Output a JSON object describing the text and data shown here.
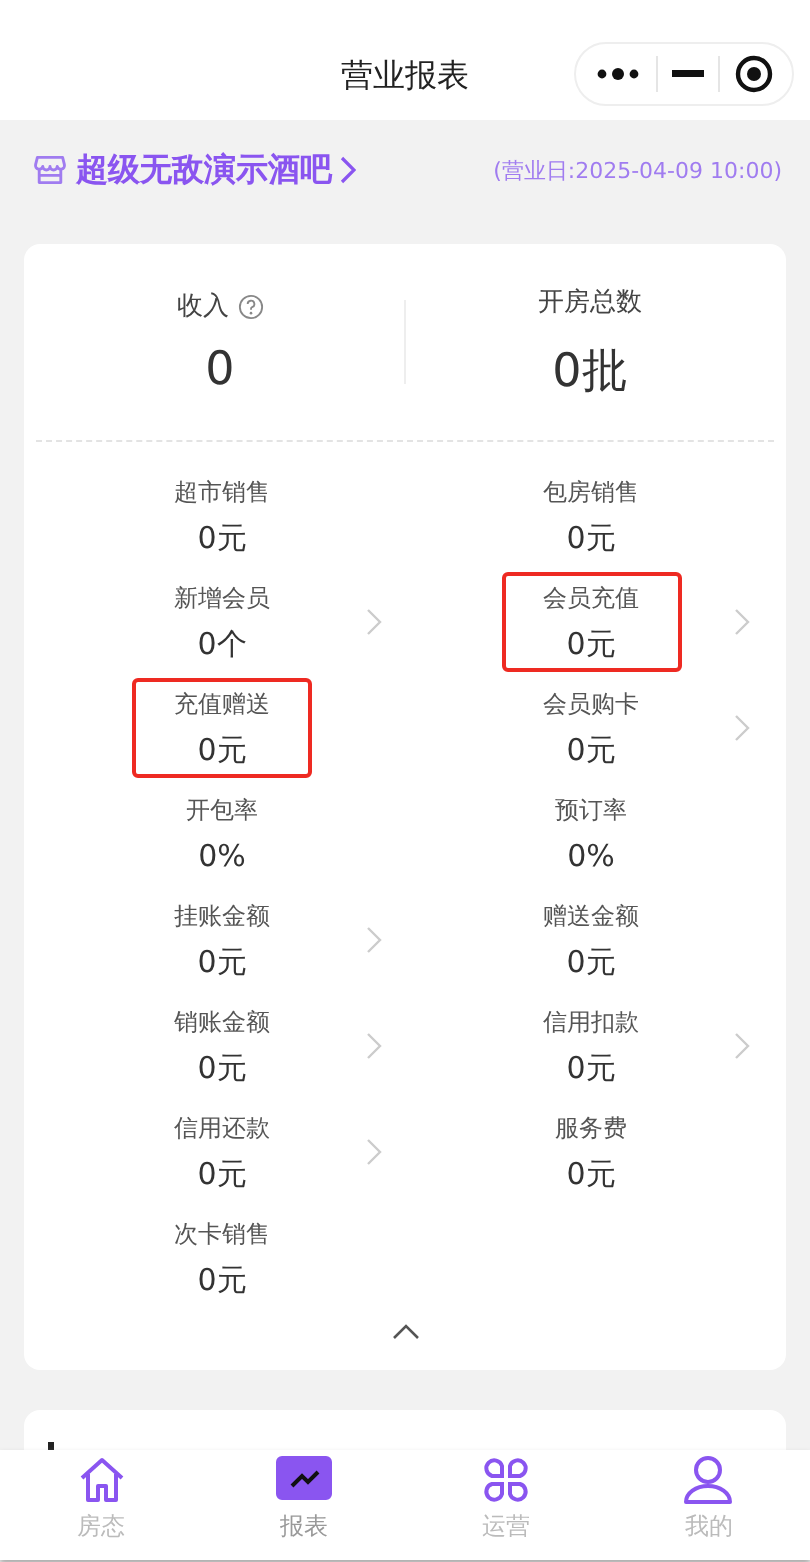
{
  "nav_bar": {
    "title": "营业报表"
  },
  "shop": {
    "name": "超级无敌演示酒吧",
    "business_day": "(营业日:2025-04-09 10:00)"
  },
  "summary": [
    {
      "label": "收入",
      "help": true,
      "value": "0"
    },
    {
      "label": "开房总数",
      "help": false,
      "value": "0批"
    }
  ],
  "metrics": [
    {
      "label": "超市销售",
      "value": "0元",
      "chevron": false,
      "highlighted": false
    },
    {
      "label": "包房销售",
      "value": "0元",
      "chevron": false,
      "highlighted": false
    },
    {
      "label": "新增会员",
      "value": "0个",
      "chevron": true,
      "highlighted": false
    },
    {
      "label": "会员充值",
      "value": "0元",
      "chevron": true,
      "highlighted": true
    },
    {
      "label": "充值赠送",
      "value": "0元",
      "chevron": false,
      "highlighted": true
    },
    {
      "label": "会员购卡",
      "value": "0元",
      "chevron": true,
      "highlighted": false
    },
    {
      "label": "开包率",
      "value": "0%",
      "chevron": false,
      "highlighted": false
    },
    {
      "label": "预订率",
      "value": "0%",
      "chevron": false,
      "highlighted": false
    },
    {
      "label": "挂账金额",
      "value": "0元",
      "chevron": true,
      "highlighted": false
    },
    {
      "label": "赠送金额",
      "value": "0元",
      "chevron": false,
      "highlighted": false
    },
    {
      "label": "销账金额",
      "value": "0元",
      "chevron": true,
      "highlighted": false
    },
    {
      "label": "信用扣款",
      "value": "0元",
      "chevron": true,
      "highlighted": false
    },
    {
      "label": "信用还款",
      "value": "0元",
      "chevron": true,
      "highlighted": false
    },
    {
      "label": "服务费",
      "value": "0元",
      "chevron": false,
      "highlighted": false
    },
    {
      "label": "次卡销售",
      "value": "0元",
      "chevron": false,
      "highlighted": false
    }
  ],
  "tab_bar": [
    {
      "kind": "home",
      "label": "房态",
      "selected": false
    },
    {
      "kind": "report",
      "label": "报表",
      "selected": true
    },
    {
      "kind": "ops",
      "label": "运营",
      "selected": false
    },
    {
      "kind": "me",
      "label": "我的",
      "selected": false
    }
  ]
}
